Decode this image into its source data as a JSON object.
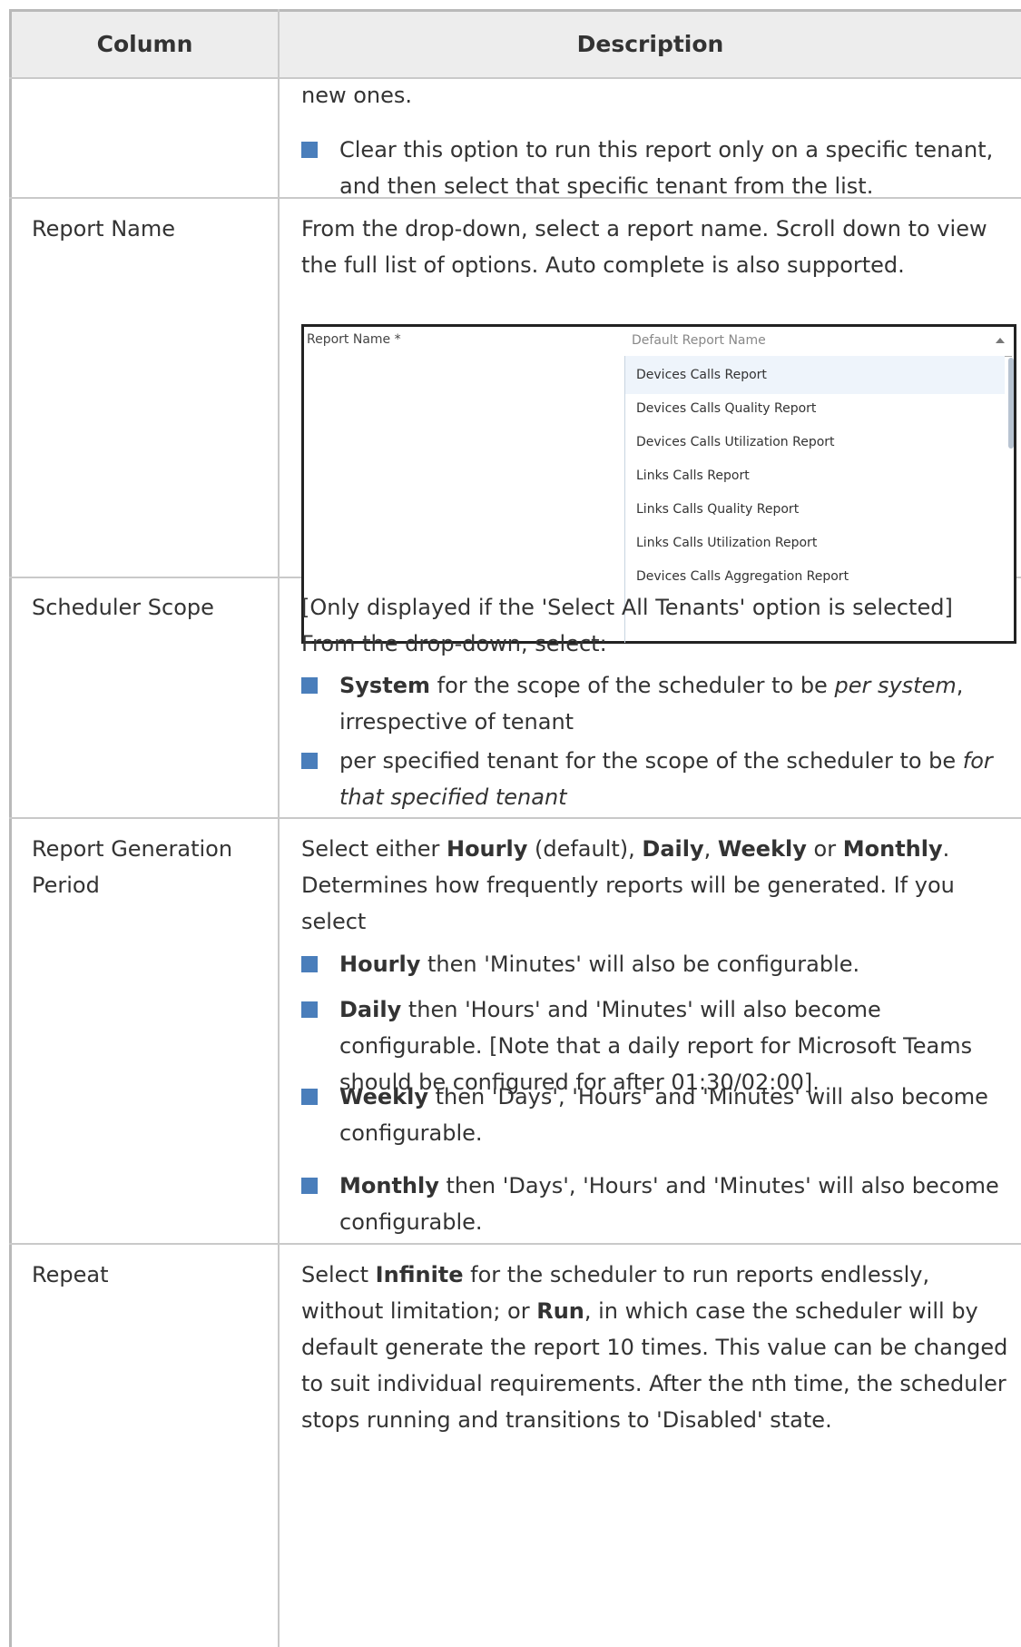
{
  "table": {
    "headers": [
      "Column",
      "Description"
    ],
    "row0": {
      "continuation": "new ones.",
      "bullets": [
        "Clear this option to run this report only on a specific tenant, and then select that specific tenant from the list."
      ]
    },
    "row1": {
      "column": "Report Name",
      "description": "From the drop-down, select a report name. Scroll down to view the full list of options. Auto complete is also supported.",
      "screenshot": {
        "field_label": "Report Name *",
        "select_value": "Default Report Name",
        "options": [
          "Devices Calls Report",
          "Devices Calls Quality Report",
          "Devices Calls Utilization Report",
          "Links Calls Report",
          "Links Calls Quality Report",
          "Links Calls Utilization Report",
          "Devices Calls Aggregation Report"
        ]
      }
    },
    "row2": {
      "column": "Scheduler Scope",
      "intro": "[Only displayed if the 'Select All Tenants' option is selected] From the drop-down, select:",
      "bullet1": {
        "bold": "System",
        "text1": " for the scope of the scheduler to be ",
        "italic": "per system",
        "text2": ", irrespective of tenant"
      },
      "bullet2": {
        "text": "per specified tenant for the scope of the scheduler to be ",
        "italic": "for that specified tenant"
      }
    },
    "row3": {
      "column": "Report Generation Period",
      "intro": {
        "t1": "Select either ",
        "b1": "Hourly",
        "t2": " (default), ",
        "b2": "Daily",
        "t3": ", ",
        "b3": "Weekly",
        "t4": " or ",
        "b4": "Monthly",
        "t5": ". Determines how frequently reports will be generated. If you select"
      },
      "bullets": [
        {
          "bold": "Hourly",
          "text": " then 'Minutes' will also be configurable."
        },
        {
          "bold": "Daily",
          "text": " then 'Hours' and 'Minutes' will also become configurable. [Note that a daily report for Microsoft Teams should be configured for after 01:30/02:00]."
        },
        {
          "bold": "Weekly",
          "text": " then 'Days', 'Hours' and 'Minutes' will also become configurable."
        },
        {
          "bold": "Monthly",
          "text": " then 'Days', 'Hours' and 'Minutes' will also become configurable."
        }
      ]
    },
    "row4": {
      "column": "Repeat",
      "t1": "Select ",
      "b1": "Infinite",
      "t2": " for the scheduler to run reports endlessly, without limitation; or ",
      "b2": "Run",
      "t3": ", in which case the scheduler will by default generate the report 10 times. This value can be changed to suit individual requirements. After the nth time, the scheduler stops running and transitions to 'Disabled' state."
    }
  }
}
